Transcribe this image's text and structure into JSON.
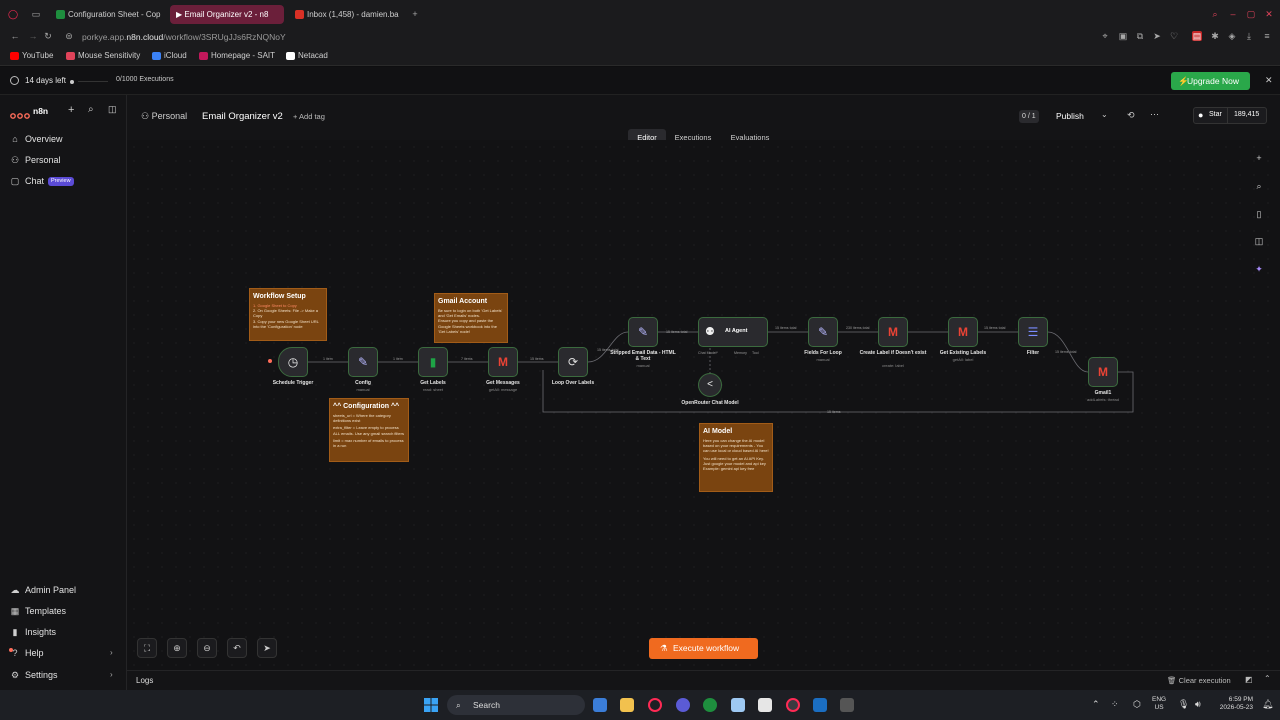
{
  "browser": {
    "tabs": [
      {
        "label": "Configuration Sheet - Cop",
        "color": "#1e8e3e"
      },
      {
        "label": "▶ Email Organizer v2 - n8",
        "color": "#e0435a"
      },
      {
        "label": "Inbox (1,458) - damien.ba",
        "color": "#d93025"
      }
    ],
    "url_prefix": "porkye.app.",
    "url_domain": "n8n.cloud",
    "url_path": "/workflow/3SRUgJJs6RzNQNoY",
    "bookmarks": [
      {
        "label": "YouTube",
        "color": "#ff0000"
      },
      {
        "label": "Mouse Sensitivity",
        "color": "#e0435a"
      },
      {
        "label": "iCloud",
        "color": "#3b82f6"
      },
      {
        "label": "Homepage - SAIT",
        "color": "#c2185b"
      },
      {
        "label": "Netacad",
        "color": "#ffffff"
      }
    ]
  },
  "trial": {
    "days_left": "14 days left",
    "executions": "0/1000 Executions",
    "upgrade_label": "Upgrade Now"
  },
  "sidebar": {
    "logo_text": "n8n",
    "items": [
      {
        "label": "Overview",
        "icon": "home-icon"
      },
      {
        "label": "Personal",
        "icon": "user-icon"
      },
      {
        "label": "Chat",
        "icon": "chat-icon",
        "badge": "Preview"
      }
    ],
    "bottom_items": [
      {
        "label": "Admin Panel",
        "icon": "cloud-icon"
      },
      {
        "label": "Templates",
        "icon": "templates-icon"
      },
      {
        "label": "Insights",
        "icon": "insights-icon"
      },
      {
        "label": "Help",
        "icon": "help-icon"
      },
      {
        "label": "Settings",
        "icon": "settings-icon"
      }
    ]
  },
  "header": {
    "breadcrumb_project": "Personal",
    "workflow_name": "Email Organizer v2",
    "add_tag": "+ Add tag",
    "version_counter": "0 / 1",
    "publish_label": "Publish",
    "star_label": "Star",
    "star_count": "189,415",
    "tabs": [
      "Editor",
      "Executions",
      "Evaluations"
    ],
    "active_tab": "Editor"
  },
  "workflow": {
    "nodes": [
      {
        "label": "Schedule Trigger",
        "sub": ""
      },
      {
        "label": "Config",
        "sub": "manual"
      },
      {
        "label": "Get Labels",
        "sub": "read: sheet"
      },
      {
        "label": "Get Messages",
        "sub": "getAll: message"
      },
      {
        "label": "Loop Over Labels",
        "sub": ""
      },
      {
        "label": "Stripped Email Data - HTML & Text",
        "sub": "manual"
      },
      {
        "label": "AI Agent",
        "sub": ""
      },
      {
        "label": "OpenRouter Chat Model",
        "sub": ""
      },
      {
        "label": "Fields For Loop",
        "sub": "manual"
      },
      {
        "label": "Create Label if Doesn't exist",
        "sub": "create: label"
      },
      {
        "label": "Get Existing Labels",
        "sub": "getAll: label"
      },
      {
        "label": "Filter",
        "sub": ""
      },
      {
        "label": "Gmail1",
        "sub": "addLabels: thread"
      }
    ],
    "edge_labels": [
      "1 item",
      "1 item",
      "7 items",
      "15 items",
      "15 items total",
      "15 items total",
      "15 items total",
      "230 items total",
      "15 items total",
      "15 items total",
      "15 items"
    ],
    "notes": {
      "setup": {
        "title": "Workflow Setup",
        "lines": [
          "1. Google Sheet to Copy",
          "2. On Google Sheets: File -> Make a Copy",
          "3. Copy your new Google Sheet URL into the 'Configuration' node"
        ]
      },
      "gmail": {
        "title": "Gmail Account",
        "lines": [
          "Be sure to login on both 'Get Labels' and 'Get Emails' nodes.",
          "Ensure you copy and paste the Google Sheets workbook into the 'Get Labels' node!"
        ]
      },
      "config": {
        "title": "^^ Configuration ^^",
        "lines": [
          "sheets_url = Where the category definitions exist",
          "extra_filter = Leave empty to process ALL emails. Use any gmail search filters",
          "limit = max number of emails to process in a run"
        ]
      },
      "ai": {
        "title": "AI Model",
        "lines": [
          "Here you can change the AI model based on your requirements - You can use local or cloud based AI here!",
          "You will need to get an AI API Key. Just google your model and api key",
          "Example: gemini api key free"
        ]
      }
    },
    "sub_ports": [
      "Chat Model*",
      "Memory",
      "Tool"
    ]
  },
  "canvas_controls": {
    "execute_label": "Execute workflow",
    "clear_label": "Clear execution",
    "logs_label": "Logs"
  },
  "taskbar": {
    "search_placeholder": "Search",
    "lang_top": "ENG",
    "lang_bottom": "US",
    "time": "6:59 PM",
    "date": "2026-05-23"
  },
  "colors": {
    "accent": "#ff6d5a",
    "upgrade": "#2aa84a",
    "note": "#7a4410",
    "execute": "#f06a1f"
  }
}
